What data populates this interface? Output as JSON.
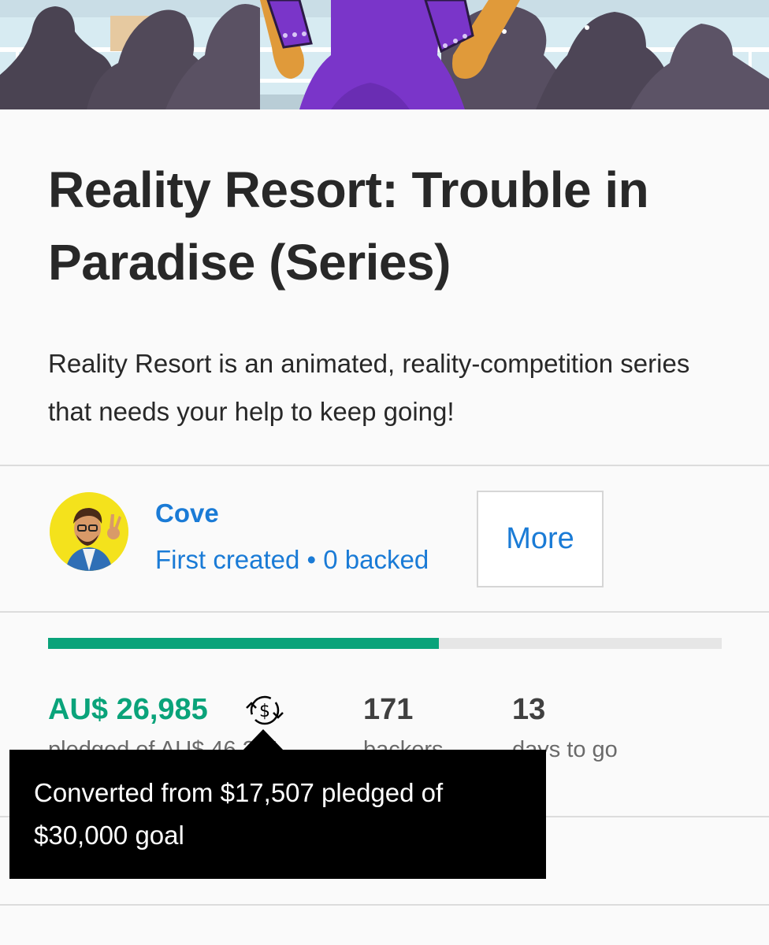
{
  "project": {
    "title": "Reality Resort: Trouble in Paradise (Series)",
    "blurb": "Reality Resort is an animated, reality-competition series that needs your help to keep going!"
  },
  "creator": {
    "name": "Cove",
    "meta": "First created • 0 backed",
    "more_label": "More"
  },
  "funding": {
    "progress_fraction": 0.58,
    "pledged_amount": "AU$ 26,985",
    "pledged_label": "pledged of AU$ 46,241",
    "backers_count": "171",
    "backers_label": "backers",
    "days_count": "13",
    "days_label": "days to go",
    "currency_icon": "currency-conversion-icon"
  },
  "tooltip": {
    "text": "Converted from $17,507 pledged of $30,000 goal"
  },
  "colors": {
    "accent_green": "#0aa37a",
    "link_blue": "#1a7bd6",
    "text_dark": "#282828",
    "tooltip_bg": "#000000"
  }
}
